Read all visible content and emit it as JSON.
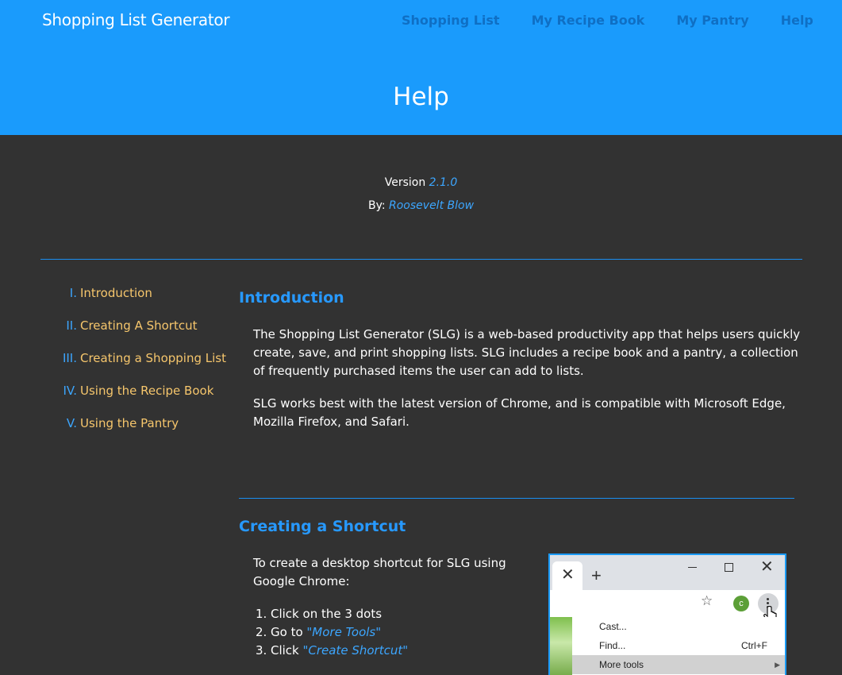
{
  "app": {
    "title": "Shopping List Generator",
    "nav": [
      "Shopping List",
      "My Recipe Book",
      "My Pantry",
      "Help"
    ]
  },
  "page": {
    "title": "Help",
    "version_label": "Version",
    "version": "2.1.0",
    "author_label": "By:",
    "author": "Roosevelt Blow"
  },
  "toc": [
    {
      "num": "I.",
      "label": "Introduction"
    },
    {
      "num": "II.",
      "label": "Creating A Shortcut"
    },
    {
      "num": "III.",
      "label": "Creating a Shopping List"
    },
    {
      "num": "IV.",
      "label": "Using the Recipe Book"
    },
    {
      "num": "V.",
      "label": "Using the Pantry"
    }
  ],
  "intro": {
    "title": "Introduction",
    "p1": "The Shopping List Generator (SLG) is a web-based productivity app that helps users quickly create, save, and print shopping lists. SLG includes a recipe book and a pantry, a collection of frequently purchased items the user can add to lists.",
    "p2": "SLG works best with the latest version of Chrome, and is compatible with Microsoft Edge, Mozilla Firefox, and Safari."
  },
  "shortcut": {
    "title": "Creating a Shortcut",
    "text": "To create a desktop shortcut for SLG using Google Chrome:",
    "steps": [
      {
        "n": "1.",
        "text": "Click on the 3 dots",
        "link": ""
      },
      {
        "n": "2.",
        "text": "Go to ",
        "link": "\"More Tools\""
      },
      {
        "n": "3.",
        "text": "Click ",
        "link": "\"Create Shortcut\""
      }
    ]
  },
  "chrome_illustration": {
    "tab_close": "✕",
    "new_tab": "+",
    "window_close": "✕",
    "star": "☆",
    "avatar": "c",
    "menu": [
      {
        "label": "Cast...",
        "shortcut": ""
      },
      {
        "label": "Find...",
        "shortcut": "Ctrl+F"
      },
      {
        "label": "More tools",
        "shortcut": ""
      }
    ]
  },
  "colors": {
    "header": "#1a9bfc",
    "background": "#323232",
    "accent": "#2799ff",
    "toc_label": "#f6c66c"
  }
}
